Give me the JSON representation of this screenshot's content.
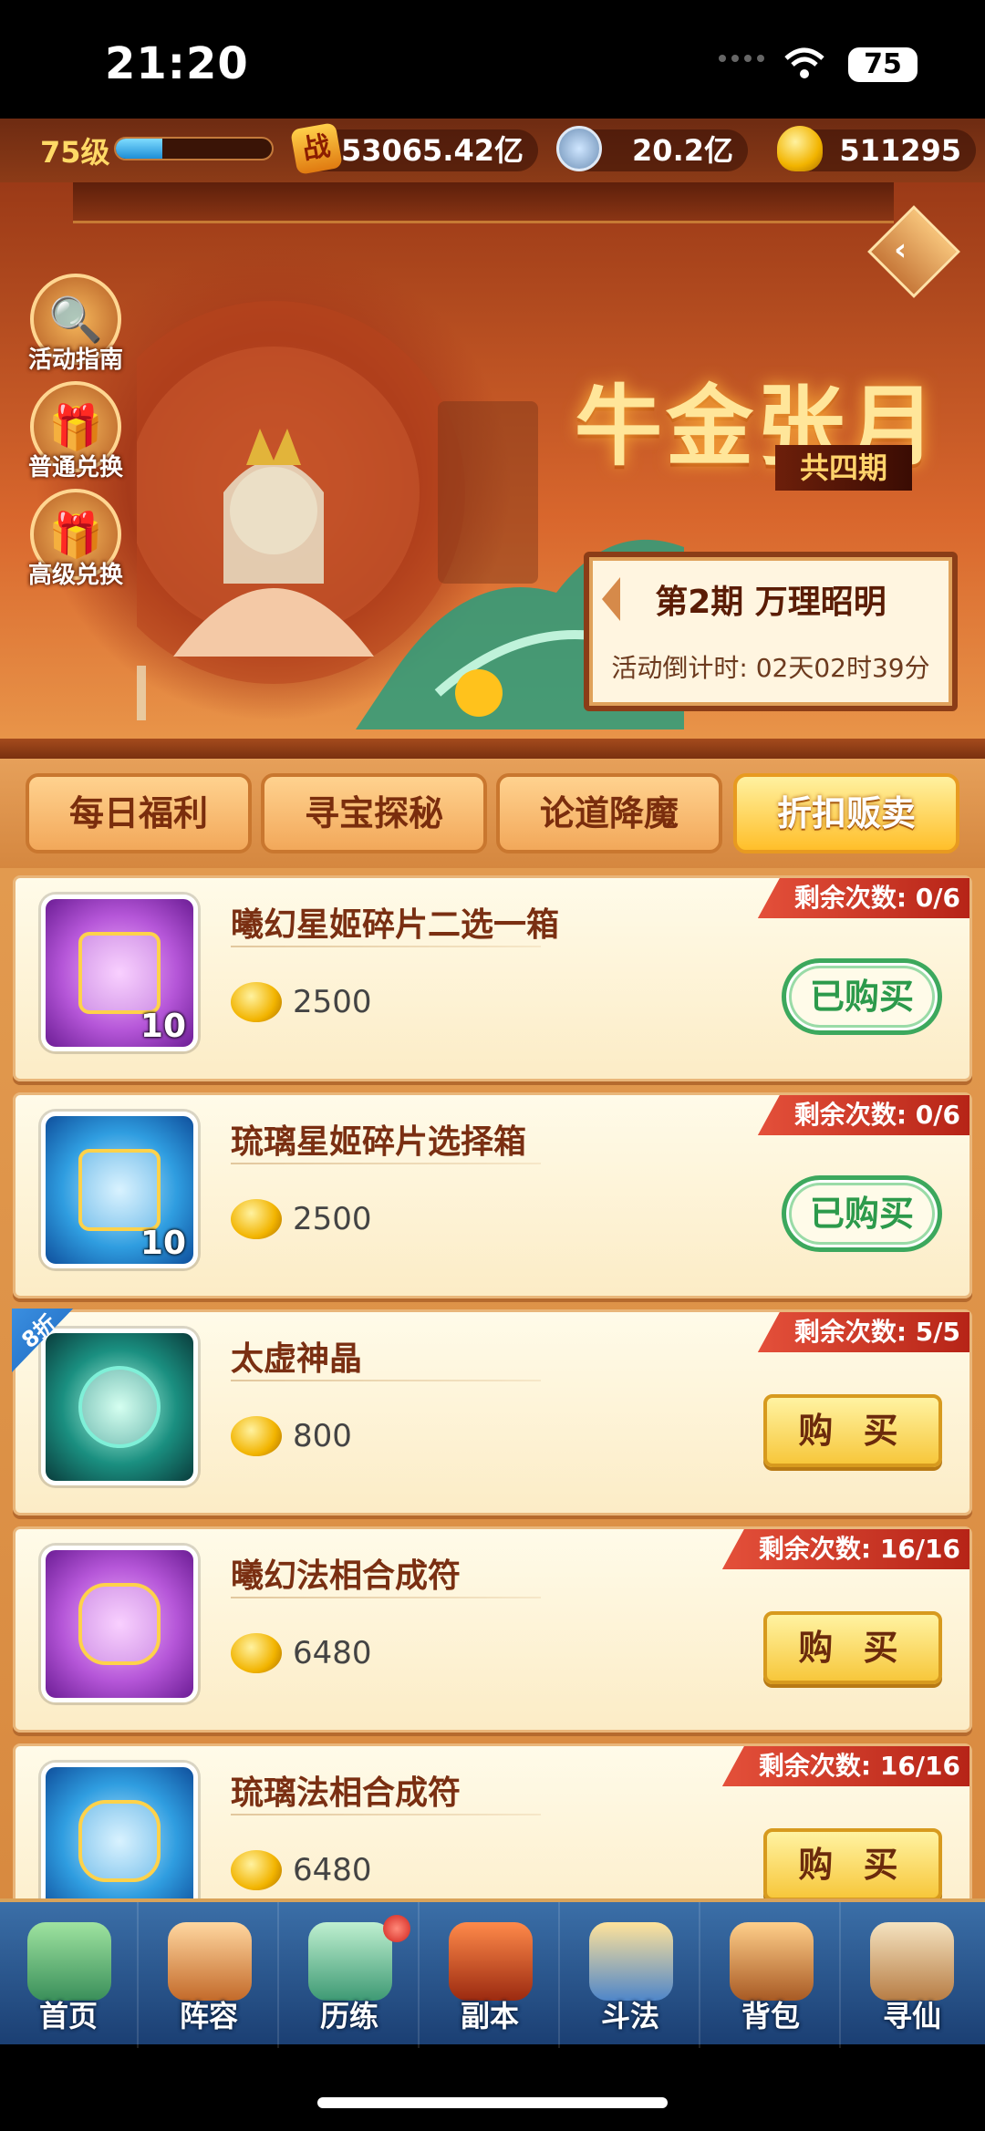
{
  "status_bar": {
    "time": "21:20",
    "battery": "75"
  },
  "resources": {
    "level": "75级",
    "level_progress": 0.3,
    "power_label": "战",
    "power": "53065.42亿",
    "copper": "20.2亿",
    "gold": "511295"
  },
  "banner": {
    "title": "牛金张月",
    "subtitle": "共四期",
    "period_title": "第2期  万理昭明",
    "countdown": "活动倒计时: 02天02时39分",
    "side_buttons": [
      {
        "label": "活动指南",
        "icon": "magnifier-icon"
      },
      {
        "label": "普通兑换",
        "icon": "gift-box-icon"
      },
      {
        "label": "高级兑换",
        "icon": "gift-box-icon"
      }
    ]
  },
  "tabs": [
    {
      "label": "每日福利",
      "active": false
    },
    {
      "label": "寻宝探秘",
      "active": false
    },
    {
      "label": "论道降魔",
      "active": false
    },
    {
      "label": "折扣贩卖",
      "active": true
    }
  ],
  "items": [
    {
      "name": "曦幻星姬碎片二选一箱",
      "price": "2500",
      "remaining": "剩余次数: 0/6",
      "action": "已购买",
      "bought": true,
      "count": "10",
      "theme": "purple",
      "discount": ""
    },
    {
      "name": "琉璃星姬碎片选择箱",
      "price": "2500",
      "remaining": "剩余次数: 0/6",
      "action": "已购买",
      "bought": true,
      "count": "10",
      "theme": "blue",
      "discount": ""
    },
    {
      "name": "太虚神晶",
      "price": "800",
      "remaining": "剩余次数: 5/5",
      "action": "购 买",
      "bought": false,
      "count": "",
      "theme": "teal",
      "discount": "8折"
    },
    {
      "name": "曦幻法相合成符",
      "price": "6480",
      "remaining": "剩余次数: 16/16",
      "action": "购 买",
      "bought": false,
      "count": "",
      "theme": "purple",
      "discount": ""
    },
    {
      "name": "琉璃法相合成符",
      "price": "6480",
      "remaining": "剩余次数: 16/16",
      "action": "购 买",
      "bought": false,
      "count": "",
      "theme": "blue",
      "discount": ""
    }
  ],
  "nav": [
    {
      "label": "首页",
      "icon": "home-island-icon"
    },
    {
      "label": "阵容",
      "icon": "cards-icon"
    },
    {
      "label": "历练",
      "icon": "training-icon"
    },
    {
      "label": "副本",
      "icon": "gate-icon"
    },
    {
      "label": "斗法",
      "icon": "battle-icon"
    },
    {
      "label": "背包",
      "icon": "bag-icon"
    },
    {
      "label": "寻仙",
      "icon": "scroll-icon"
    }
  ],
  "colors": {
    "accent": "#f7c73b",
    "bought_green": "#3ca85d",
    "remaining_red": "#e4503a",
    "nav_blue": "#1b3f73"
  }
}
